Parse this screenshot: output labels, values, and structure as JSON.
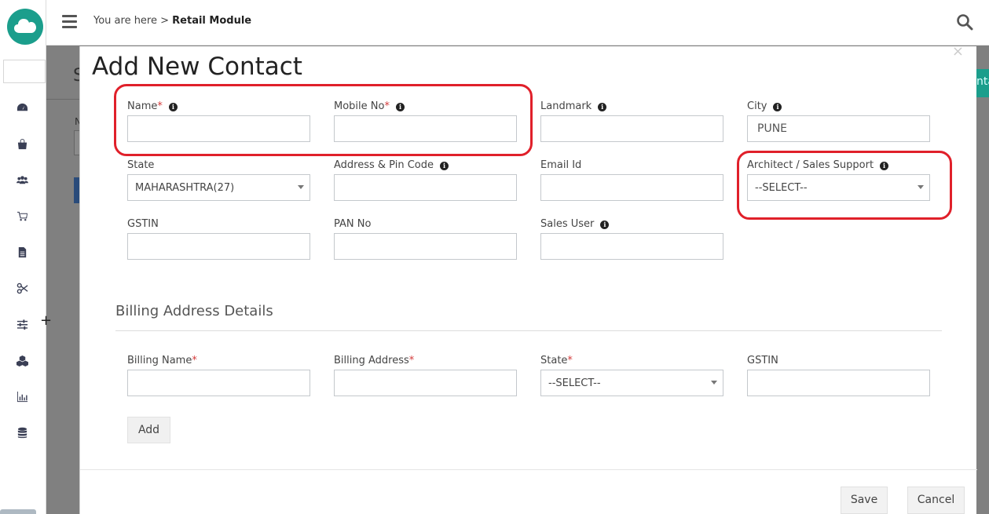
{
  "header": {
    "breadcrumb_prefix": "You are here > ",
    "breadcrumb_current": "Retail Module"
  },
  "background": {
    "page_title_fragment": "S",
    "label_fragment": "N",
    "plus": "+",
    "green_button_fragment": "nta"
  },
  "sidebar": {
    "icons": [
      "dashboard-icon",
      "shopping-bag-icon",
      "users-icon",
      "cart-icon",
      "document-icon",
      "scissors-icon",
      "sliders-icon",
      "cubes-icon",
      "bar-chart-icon",
      "database-icon"
    ]
  },
  "modal": {
    "title": "Add New Contact",
    "close": "×",
    "fields": {
      "name": {
        "label": "Name",
        "required": "*",
        "value": ""
      },
      "mobile": {
        "label": "Mobile No",
        "required": "*",
        "value": ""
      },
      "landmark": {
        "label": "Landmark",
        "value": ""
      },
      "city": {
        "label": "City",
        "value": "PUNE"
      },
      "state": {
        "label": "State",
        "selected": "MAHARASHTRA(27)"
      },
      "address": {
        "label": "Address & Pin Code",
        "value": ""
      },
      "email": {
        "label": "Email Id",
        "value": ""
      },
      "architect": {
        "label": "Architect / Sales Support",
        "selected": "--SELECT--"
      },
      "gstin": {
        "label": "GSTIN",
        "value": ""
      },
      "pan": {
        "label": "PAN No",
        "value": ""
      },
      "sales_user": {
        "label": "Sales User",
        "value": ""
      }
    },
    "billing": {
      "section_title": "Billing Address Details",
      "name": {
        "label": "Billing Name",
        "required": "*",
        "value": ""
      },
      "address": {
        "label": "Billing Address",
        "required": "*",
        "value": ""
      },
      "state": {
        "label": "State",
        "required": "*",
        "selected": "--SELECT--"
      },
      "gstin": {
        "label": "GSTIN",
        "value": ""
      },
      "add_label": "Add"
    },
    "footer": {
      "save_label": "Save",
      "cancel_label": "Cancel"
    }
  },
  "colors": {
    "brand": "#1b9e8c",
    "highlight": "#e0202a",
    "required": "#d43b3b"
  }
}
